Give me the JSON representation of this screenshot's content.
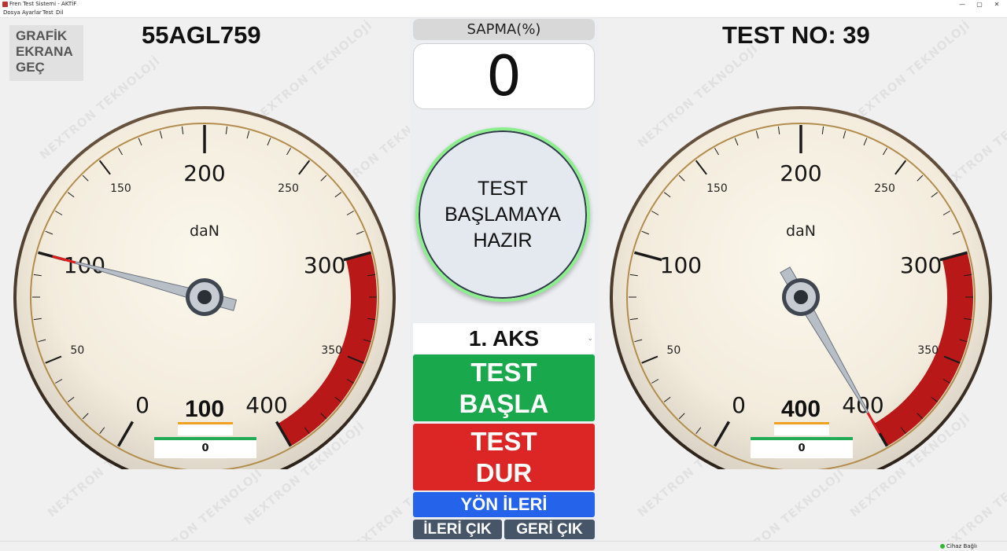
{
  "window": {
    "title": "Fren Test Sistemi - AKTİF",
    "controls": [
      "—",
      "▢",
      "✕"
    ]
  },
  "menu": [
    "Dosya",
    "Ayarlar",
    "Test",
    "Dil"
  ],
  "watermark_text": "NEXTRON TEKNOLOJİ",
  "header": {
    "switch_button": [
      "GRAFİK",
      "EKRANA",
      "GEÇ"
    ],
    "plate": "55AGL759",
    "test_no": "TEST NO: 39"
  },
  "gauge_scale": {
    "min": 0,
    "max": 400,
    "major_labels": [
      "0",
      "100",
      "200",
      "300",
      "400"
    ],
    "minor_labels": [
      "50",
      "150",
      "250",
      "350"
    ],
    "unit": "daN",
    "red_zone_start": 300
  },
  "gauges": [
    {
      "id": "left",
      "value": 100,
      "value_text": "100",
      "sub_value": "0"
    },
    {
      "id": "right",
      "value": 400,
      "value_text": "400",
      "sub_value": "0"
    }
  ],
  "center": {
    "sapma_label": "SAPMA(%)",
    "sapma_value": "0",
    "status_lines": [
      "TEST",
      "BAŞLAMAYA",
      "HAZIR"
    ],
    "axle_select": "1. AKS",
    "start_lines": [
      "TEST",
      "BAŞLA"
    ],
    "stop_lines": [
      "TEST",
      "DUR"
    ],
    "direction": "YÖN İLERİ",
    "forward_exit": "İLERİ ÇIK",
    "back_exit": "GERİ ÇIK"
  },
  "statusbar": {
    "label": "Cihaz Bağlı"
  },
  "colors": {
    "start": "#19a84b",
    "stop": "#dc2626",
    "direction": "#2563eb",
    "exit": "#475569",
    "red_zone": "#b81818"
  }
}
